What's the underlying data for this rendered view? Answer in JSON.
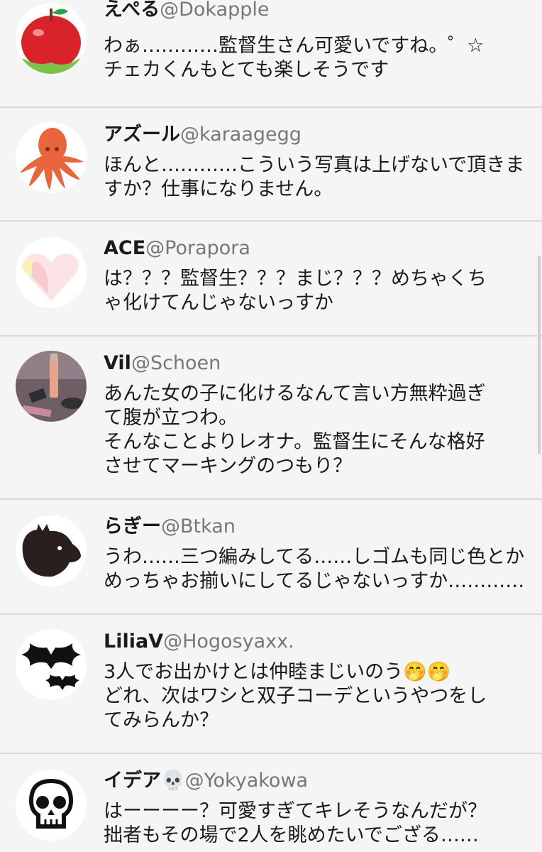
{
  "posts": [
    {
      "name": "えぺる",
      "handle": "@Dokapple",
      "avatar": "apple-icon",
      "lines": [
        "わぁ…………監督生さん可愛いですね。゜☆",
        "チェカくんもとても楽しそうです"
      ]
    },
    {
      "name": "アズール",
      "handle": "@karaagegg",
      "avatar": "octopus-icon",
      "lines": [
        "ほんと…………こういう写真は上げないで頂きま",
        "すか？仕事になりません。"
      ]
    },
    {
      "name": "ACE",
      "handle": "@Porapora",
      "avatar": "heart-icon",
      "lines": [
        "は？？？監督生？？？まじ？？？めちゃくち",
        "ゃ化けてんじゃないっすか"
      ]
    },
    {
      "name": "Vil",
      "handle": "@Schoen",
      "avatar": "cosmetics-photo",
      "lines": [
        "あんた女の子に化けるなんて言い方無粋過ぎ",
        "て腹が立つわ。",
        "そんなことよりレオナ。監督生にそんな格好",
        "させてマーキングのつもり？"
      ]
    },
    {
      "name": "らぎー",
      "handle": "@Btkan",
      "avatar": "hyena-icon",
      "lines": [
        "うわ……三つ編みしてる……しゴムも同じ色とか",
        "めっちゃお揃いにしてるじゃないっすか…………"
      ]
    },
    {
      "name": "LiliaV",
      "handle": "@Hogosyaxx.",
      "avatar": "bat-icon",
      "lines": [
        "3人でお出かけとは仲睦まじいのう🤭🤭",
        "どれ、次はワシと双子コーデというやつをし",
        "てみらんか？"
      ]
    },
    {
      "name": "イデア💀",
      "handle": "@Yokyakowa",
      "avatar": "skull-icon",
      "lines": [
        "はーーーー？可愛すぎてキレそうなんだが？",
        "拙者もその場で2人を眺めたいでござる……"
      ]
    }
  ],
  "colors": {
    "background": "#f5f5f5",
    "divider": "#dadada",
    "handle": "#777777",
    "apple": "#d8232a",
    "octopus": "#e8653e"
  }
}
